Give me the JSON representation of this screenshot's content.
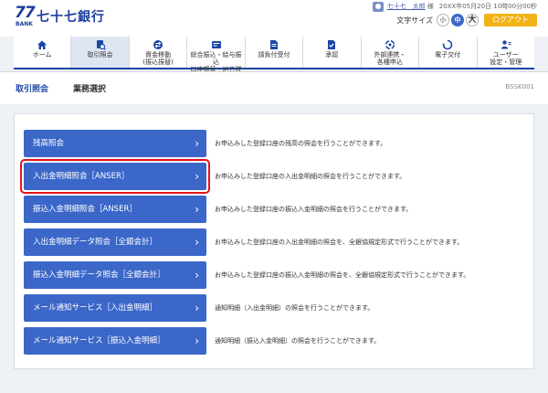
{
  "header": {
    "logo_mark": "77",
    "logo_bank": "BANK",
    "logo_name": "七十七銀行",
    "user_name": "七十七　太郎",
    "user_honorific": "様",
    "datetime": "20XX年05月20日 10時00分00秒",
    "font_size_label": "文字サイズ",
    "font_small": "小",
    "font_medium": "中",
    "font_large": "大",
    "logout_label": "ログアウト"
  },
  "nav": {
    "items": [
      {
        "label": "ホーム",
        "icon": "home-icon"
      },
      {
        "label": "取引照会",
        "icon": "inquiry-icon"
      },
      {
        "label": "資金移動\n(振込振替)",
        "icon": "transfer-icon"
      },
      {
        "label": "総合振込・給与振込\n口座振替・地方税",
        "icon": "bulk-transfer-icon"
      },
      {
        "label": "請負付受付",
        "icon": "document-icon"
      },
      {
        "label": "承認",
        "icon": "approval-icon"
      },
      {
        "label": "外部連携・\n各種申込",
        "icon": "link-icon"
      },
      {
        "label": "電子交付",
        "icon": "delivery-icon"
      },
      {
        "label": "ユーザー\n設定・管理",
        "icon": "user-admin-icon"
      }
    ],
    "active_index": 1,
    "accent_color": "#1c47a6"
  },
  "breadcrumb": {
    "main": "取引照会",
    "sub": "業務選択",
    "screen_id": "BSSK001"
  },
  "menu": {
    "button_color": "#3b67c9",
    "highlight_color": "#e3141c",
    "items": [
      {
        "label": "残高照会",
        "desc": "お申込みした登録口座の残高の照会を行うことができます。"
      },
      {
        "label": "入出金明細照会［ANSER］",
        "desc": "お申込みした登録口座の入出金明細の照会を行うことができます。"
      },
      {
        "label": "振込入金明細照会［ANSER］",
        "desc": "お申込みした登録口座の振込入金明細の照会を行うことができます。"
      },
      {
        "label": "入出金明細データ照会［全銀会計］",
        "desc": "お申込みした登録口座の入出金明細の照会を、全銀協規定形式で行うことができます。"
      },
      {
        "label": "振込入金明細データ照会［全銀会計］",
        "desc": "お申込みした登録口座の振込入金明細の照会を、全銀協規定形式で行うことができます。"
      },
      {
        "label": "メール通知サービス［入出金明細］",
        "desc": "通知明細（入出金明細）の照会を行うことができます。"
      },
      {
        "label": "メール通知サービス［振込入金明細］",
        "desc": "通知明細（振込入金明細）の照会を行うことができます。"
      }
    ],
    "highlighted_index": 1
  }
}
